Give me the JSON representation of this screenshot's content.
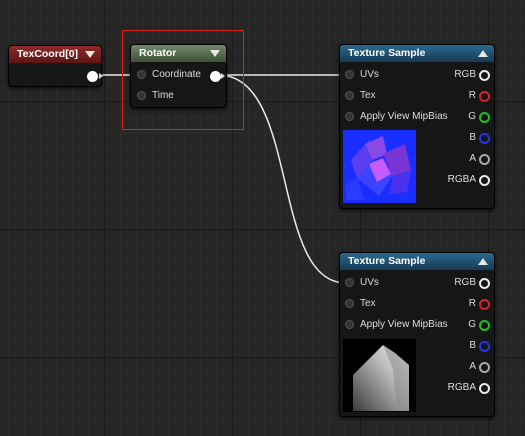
{
  "nodes": {
    "texcoord": {
      "title": "TexCoord[0]"
    },
    "rotator": {
      "title": "Rotator",
      "inputs": [
        "Coordinate",
        "Time"
      ]
    },
    "texture1": {
      "title": "Texture Sample",
      "inputs": [
        "UVs",
        "Tex",
        "Apply View MipBias"
      ],
      "outputs": [
        "RGB",
        "R",
        "G",
        "B",
        "A",
        "RGBA"
      ]
    },
    "texture2": {
      "title": "Texture Sample",
      "inputs": [
        "UVs",
        "Tex",
        "Apply View MipBias"
      ],
      "outputs": [
        "RGB",
        "R",
        "G",
        "B",
        "A",
        "RGBA"
      ]
    }
  },
  "colors": {
    "red_pin": "#e02020",
    "green_pin": "#22c022",
    "blue_pin": "#2233ee",
    "selection": "#e02020"
  },
  "icons": {
    "collapse": "chevron-down-icon",
    "expand": "chevron-up-icon"
  }
}
